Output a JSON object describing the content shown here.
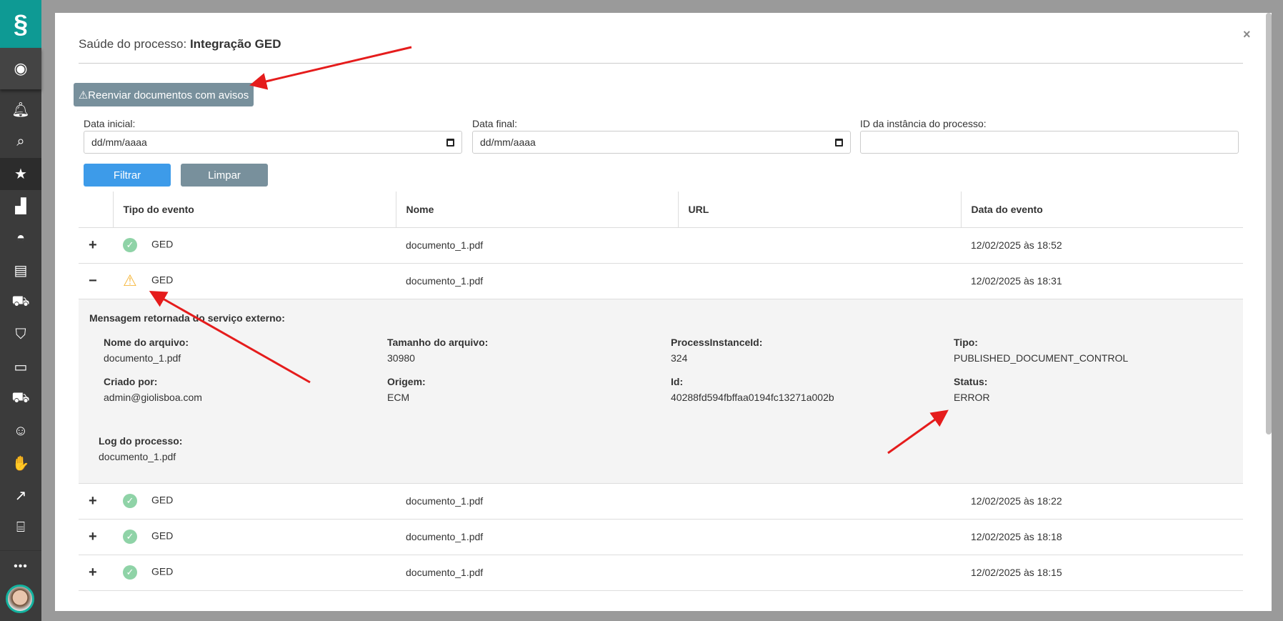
{
  "sidebar": {
    "icons": [
      "logo",
      "user-circle",
      "bell",
      "search",
      "star",
      "chart",
      "helmet",
      "document",
      "tractor",
      "shield",
      "archive",
      "trucks",
      "team",
      "handshake",
      "trend-up",
      "briefcase"
    ],
    "more": "•••"
  },
  "modal": {
    "title_prefix": "Saúde do processo:",
    "title_name": "Integração GED",
    "close": "×"
  },
  "resend_button": "⚠Reenviar documentos com avisos",
  "filters": {
    "start_label": "Data inicial:",
    "start_placeholder": "dd/mm/aaaa",
    "end_label": "Data final:",
    "end_placeholder": "dd/mm/aaaa",
    "id_label": "ID da instância do processo:",
    "id_value": "",
    "filter_button": "Filtrar",
    "clear_button": "Limpar"
  },
  "table": {
    "headers": [
      "Tipo do evento",
      "Nome",
      "URL",
      "Data do evento"
    ],
    "rows": [
      {
        "toggle": "+",
        "status": "success",
        "type": "GED",
        "name": "documento_1.pdf",
        "url": "",
        "date": "12/02/2025 às 18:52"
      },
      {
        "toggle": "−",
        "status": "warning",
        "type": "GED",
        "name": "documento_1.pdf",
        "url": "",
        "date": "12/02/2025 às 18:31"
      },
      {
        "toggle": "+",
        "status": "success",
        "type": "GED",
        "name": "documento_1.pdf",
        "url": "",
        "date": "12/02/2025 às 18:22"
      },
      {
        "toggle": "+",
        "status": "success",
        "type": "GED",
        "name": "documento_1.pdf",
        "url": "",
        "date": "12/02/2025 às 18:18"
      },
      {
        "toggle": "+",
        "status": "success",
        "type": "GED",
        "name": "documento_1.pdf",
        "url": "",
        "date": "12/02/2025 às 18:15"
      }
    ]
  },
  "detail": {
    "title": "Mensagem retornada do serviço externo:",
    "fields": [
      {
        "label": "Nome do arquivo:",
        "value": "documento_1.pdf"
      },
      {
        "label": "Tamanho do arquivo:",
        "value": "30980"
      },
      {
        "label": "ProcessInstanceId:",
        "value": "324"
      },
      {
        "label": "Tipo:",
        "value": "PUBLISHED_DOCUMENT_CONTROL"
      },
      {
        "label": "Criado por:",
        "value": "admin@giolisboa.com"
      },
      {
        "label": "Origem:",
        "value": "ECM"
      },
      {
        "label": "Id:",
        "value": "40288fd594fbffaa0194fc13271a002b"
      },
      {
        "label": "Status:",
        "value": "ERROR"
      }
    ],
    "log_label": "Log do processo:",
    "log_value": "documento_1.pdf"
  },
  "colors": {
    "accent": "#3d9be9",
    "muted_button": "#78909c",
    "teal": "#0e9a94",
    "annotation": "#e51c1c"
  }
}
